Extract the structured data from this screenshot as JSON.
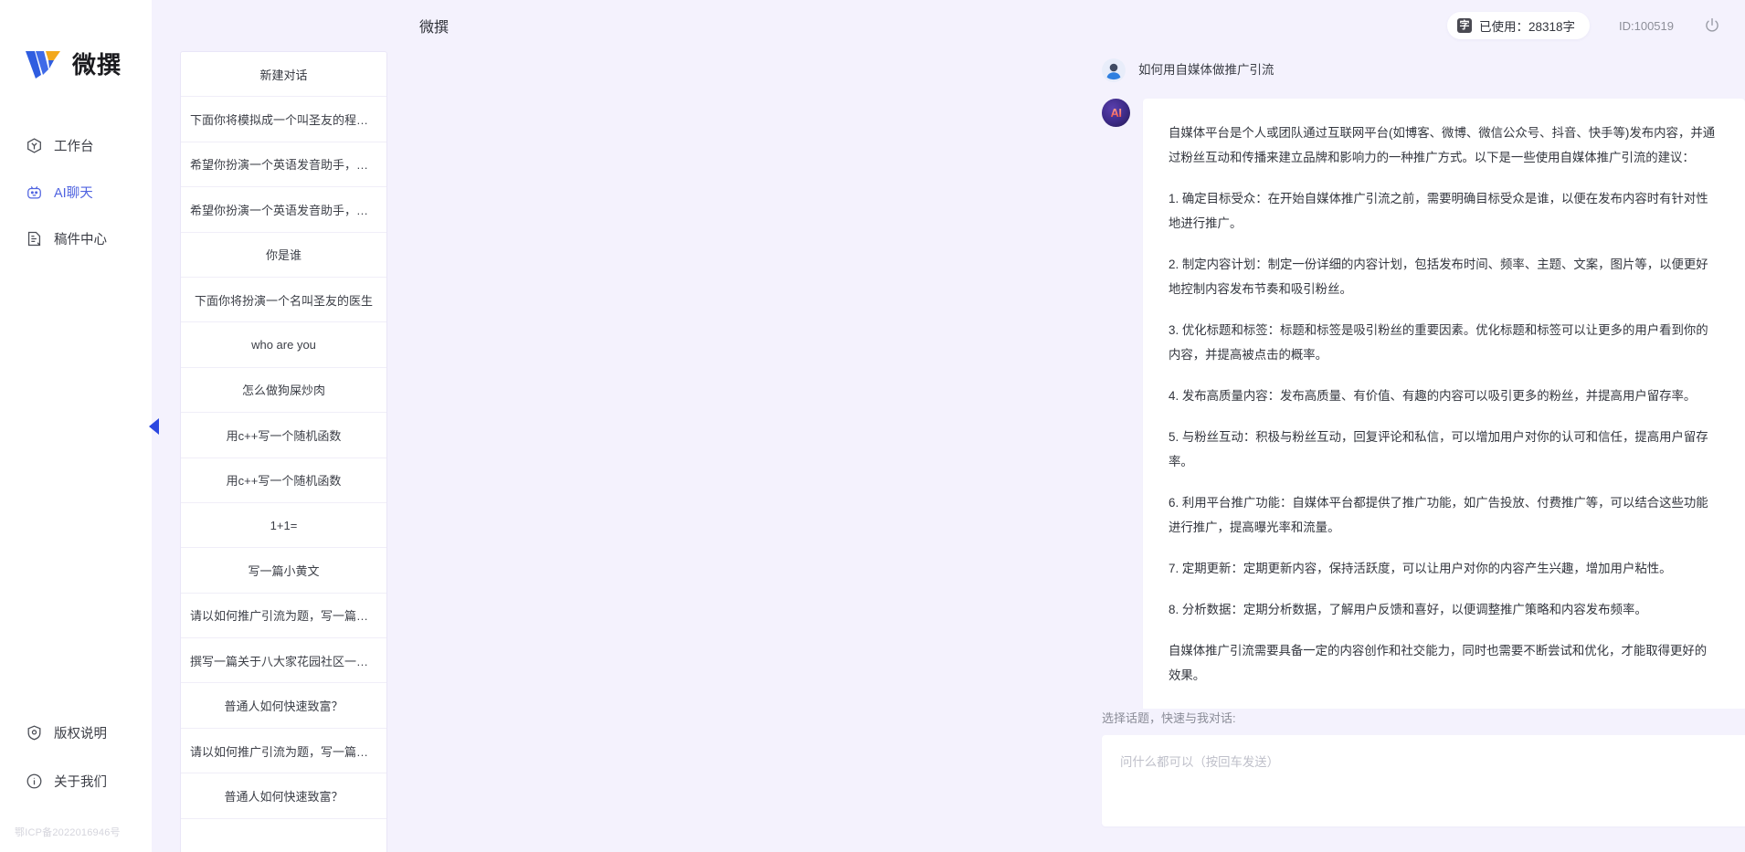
{
  "brand": {
    "name": "微撰",
    "logo_icon": "w-logo-icon"
  },
  "sidebar": {
    "items": [
      {
        "label": "工作台",
        "icon": "workbench-icon",
        "active": false
      },
      {
        "label": "AI聊天",
        "icon": "ai-chat-icon",
        "active": true
      },
      {
        "label": "稿件中心",
        "icon": "document-center-icon",
        "active": false
      }
    ],
    "bottom_items": [
      {
        "label": "版权说明",
        "icon": "shield-icon"
      },
      {
        "label": "关于我们",
        "icon": "info-icon"
      }
    ],
    "icp": "鄂ICP备2022016946号",
    "collapse_icon": "chevron-left-icon"
  },
  "header": {
    "title": "微撰",
    "usage_badge": "字",
    "usage_label": "已使用：28318字",
    "user_id": "ID:100519",
    "power_icon": "power-icon"
  },
  "conversations": {
    "new_label": "新建对话",
    "items": [
      "下面你将模拟成一个叫圣友的程序员，我说...",
      "希望你扮演一个英语发音助手，我提供给你...",
      "希望你扮演一个英语发音助手，我提供给你...",
      "你是谁",
      "下面你将扮演一个名叫圣友的医生",
      "who are you",
      "怎么做狗屎炒肉",
      "用c++写一个随机函数",
      "用c++写一个随机函数",
      "1+1=",
      "写一篇小黄文",
      "请以如何推广引流为题，写一篇大纲",
      "撰写一篇关于八大家花园社区一刻钟便民生...",
      "普通人如何快速致富？",
      "请以如何推广引流为题，写一篇大纲",
      "普通人如何快速致富？"
    ]
  },
  "chat": {
    "user": {
      "avatar_icon": "user-avatar-icon",
      "text": "如何用自媒体做推广引流"
    },
    "assistant": {
      "avatar_icon": "ai-avatar-icon",
      "avatar_label": "AI",
      "paragraphs": [
        "自媒体平台是个人或团队通过互联网平台(如博客、微博、微信公众号、抖音、快手等)发布内容，并通过粉丝互动和传播来建立品牌和影响力的一种推广方式。以下是一些使用自媒体推广引流的建议：",
        "1. 确定目标受众：在开始自媒体推广引流之前，需要明确目标受众是谁，以便在发布内容时有针对性地进行推广。",
        "2. 制定内容计划：制定一份详细的内容计划，包括发布时间、频率、主题、文案，图片等，以便更好地控制内容发布节奏和吸引粉丝。",
        "3. 优化标题和标签：标题和标签是吸引粉丝的重要因素。优化标题和标签可以让更多的用户看到你的内容，并提高被点击的概率。",
        "4. 发布高质量内容：发布高质量、有价值、有趣的内容可以吸引更多的粉丝，并提高用户留存率。",
        "5. 与粉丝互动：积极与粉丝互动，回复评论和私信，可以增加用户对你的认可和信任，提高用户留存率。",
        "6. 利用平台推广功能：自媒体平台都提供了推广功能，如广告投放、付费推广等，可以结合这些功能进行推广，提高曝光率和流量。",
        "7. 定期更新：定期更新内容，保持活跃度，可以让用户对你的内容产生兴趣，增加用户粘性。",
        "8. 分析数据：定期分析数据，了解用户反馈和喜好，以便调整推广策略和内容发布频率。",
        "自媒体推广引流需要具备一定的内容创作和社交能力，同时也需要不断尝试和优化，才能取得更好的效果。"
      ]
    }
  },
  "composer": {
    "label": "选择话题，快速与我对话:",
    "placeholder": "问什么都可以（按回车发送）",
    "value": "",
    "send_icon": "send-icon"
  },
  "colors": {
    "background": "#f4f2fd",
    "panel": "#ffffff",
    "accent": "#4f63e0",
    "send_button": "#3b5ae8"
  }
}
